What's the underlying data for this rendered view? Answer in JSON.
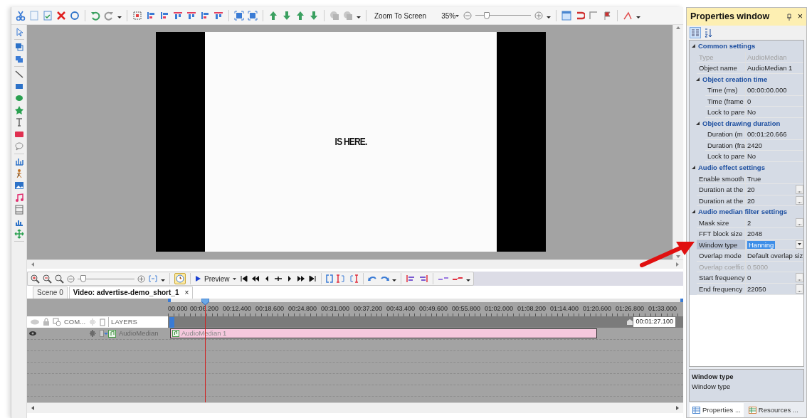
{
  "toolbar": {
    "zoom_mode": "Zoom To Screen",
    "zoom_percent": "35%",
    "zoom_slider": {
      "level": 0.2
    }
  },
  "canvas": {
    "caption": "IS HERE."
  },
  "timeline_toolbar": {
    "zoom_slider": {
      "level": 0.1
    },
    "timer_on": true,
    "preview_label": "Preview"
  },
  "document_tabs": [
    {
      "label": "Scene 0",
      "selected": false
    },
    {
      "label": "Video: advertise-demo_short_1",
      "selected": true,
      "close": "×"
    }
  ],
  "timeline": {
    "ruler": [
      "00.000",
      "00:06.200",
      "00:12.400",
      "00:18.600",
      "00:24.800",
      "00:31.000",
      "00:37.200",
      "00:43.400",
      "00:49.600",
      "00:55.800",
      "01:02.000",
      "01:08.200",
      "01:14.400",
      "01:20.600",
      "01:26.800",
      "01:33.000"
    ],
    "end_time": "00:01:27.100",
    "columns": [
      "COM...",
      "LAYERS"
    ],
    "layers": [
      {
        "name": "AudioMedian",
        "visible": true,
        "clip": "AudioMedian 1"
      }
    ]
  },
  "properties": {
    "title": "Properties window",
    "close": "×",
    "sections": [
      {
        "title": "Common settings",
        "expanded": true,
        "rows": [
          {
            "name": "Type",
            "value": "AudioMedian",
            "kind": "text",
            "disabled": true,
            "selected": false
          },
          {
            "name": "Object name",
            "value": "AudioMedian 1",
            "kind": "text",
            "disabled": false,
            "selected": false
          }
        ],
        "children": [
          {
            "title": "Object creation time",
            "expanded": true,
            "rows": [
              {
                "name": "Time (ms)",
                "value": "00:00:00.000",
                "kind": "text",
                "disabled": false,
                "selected": false
              },
              {
                "name": "Time (frame",
                "value": "0",
                "kind": "text",
                "disabled": false,
                "selected": false
              },
              {
                "name": "Lock to pare",
                "value": "No",
                "kind": "text",
                "disabled": false,
                "selected": false
              }
            ]
          },
          {
            "title": "Object drawing duration",
            "expanded": true,
            "rows": [
              {
                "name": "Duration (m",
                "value": "00:01:20.666",
                "kind": "text",
                "disabled": false,
                "selected": false
              },
              {
                "name": "Duration (fra",
                "value": "2420",
                "kind": "text",
                "disabled": false,
                "selected": false
              },
              {
                "name": "Lock to pare",
                "value": "No",
                "kind": "text",
                "disabled": false,
                "selected": false
              }
            ]
          }
        ]
      },
      {
        "title": "Audio effect settings",
        "expanded": true,
        "rows": [
          {
            "name": "Enable smooth",
            "value": "True",
            "kind": "text",
            "disabled": false,
            "selected": false
          },
          {
            "name": "Duration at the",
            "value": "20",
            "kind": "ellipsis",
            "disabled": false,
            "selected": false
          },
          {
            "name": "Duration at the",
            "value": "20",
            "kind": "ellipsis",
            "disabled": false,
            "selected": false
          }
        ]
      },
      {
        "title": "Audio median filter settings",
        "expanded": true,
        "rows": [
          {
            "name": "Mask size",
            "value": "2",
            "kind": "ellipsis",
            "disabled": false,
            "selected": false
          },
          {
            "name": "FFT block size",
            "value": "2048",
            "kind": "text",
            "disabled": false,
            "selected": false
          },
          {
            "name": "Window type",
            "value": "Hanning",
            "kind": "dropdown",
            "disabled": false,
            "selected": true
          },
          {
            "name": "Overlap mode",
            "value": "Default overlap siz",
            "kind": "text",
            "disabled": false,
            "selected": false
          },
          {
            "name": "Overlap coeffic",
            "value": "0.5000",
            "kind": "text",
            "disabled": true,
            "selected": false
          },
          {
            "name": "Start frequency",
            "value": "0",
            "kind": "ellipsis",
            "disabled": false,
            "selected": false
          },
          {
            "name": "End frequency",
            "value": "22050",
            "kind": "ellipsis",
            "disabled": false,
            "selected": false
          }
        ]
      }
    ],
    "description": {
      "title": "Window type",
      "text": "Window type"
    },
    "tabs": [
      {
        "label": "Properties ...",
        "selected": true
      },
      {
        "label": "Resources ...",
        "selected": false
      }
    ]
  }
}
